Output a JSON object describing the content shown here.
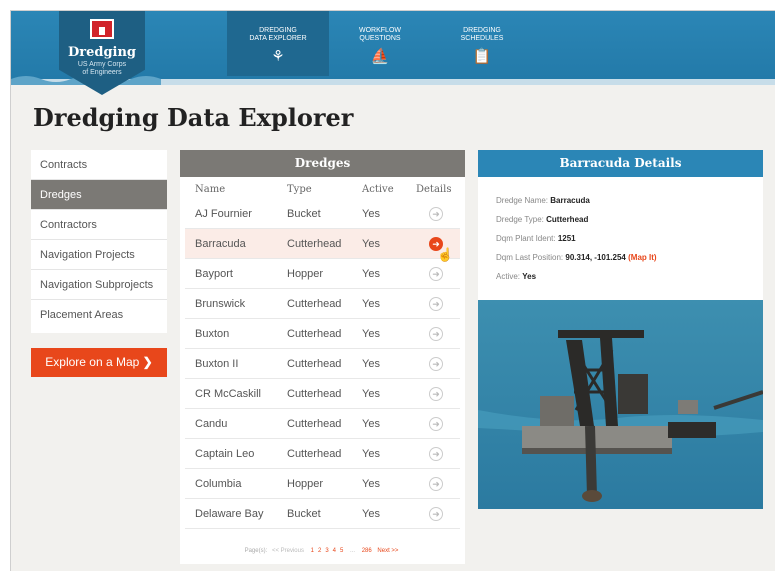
{
  "logo": {
    "title": "Dredging",
    "subtitle_line1": "US Army Corps",
    "subtitle_line2": "of Engineers"
  },
  "nav": [
    {
      "label_line1": "Dredging",
      "label_line2": "Data Explorer",
      "icon": "ship-icon"
    },
    {
      "label_line1": "Workflow",
      "label_line2": "Questions",
      "icon": "dredge-icon"
    },
    {
      "label_line1": "Dredging",
      "label_line2": "Schedules",
      "icon": "clipboard-icon"
    }
  ],
  "page_title": "Dredging Data Explorer",
  "sidebar": {
    "items": [
      {
        "label": "Contracts"
      },
      {
        "label": "Dredges"
      },
      {
        "label": "Contractors"
      },
      {
        "label": "Navigation Projects"
      },
      {
        "label": "Navigation Subprojects"
      },
      {
        "label": "Placement Areas"
      }
    ],
    "active_index": 1
  },
  "map_button": {
    "label": "Explore on a Map"
  },
  "dredges": {
    "title": "Dredges",
    "columns": {
      "name": "Name",
      "type": "Type",
      "active": "Active",
      "details": "Details"
    },
    "rows": [
      {
        "name": "AJ Fournier",
        "type": "Bucket",
        "active": "Yes"
      },
      {
        "name": "Barracuda",
        "type": "Cutterhead",
        "active": "Yes"
      },
      {
        "name": "Bayport",
        "type": "Hopper",
        "active": "Yes"
      },
      {
        "name": "Brunswick",
        "type": "Cutterhead",
        "active": "Yes"
      },
      {
        "name": "Buxton",
        "type": "Cutterhead",
        "active": "Yes"
      },
      {
        "name": "Buxton II",
        "type": "Cutterhead",
        "active": "Yes"
      },
      {
        "name": "CR McCaskill",
        "type": "Cutterhead",
        "active": "Yes"
      },
      {
        "name": "Candu",
        "type": "Cutterhead",
        "active": "Yes"
      },
      {
        "name": "Captain Leo",
        "type": "Cutterhead",
        "active": "Yes"
      },
      {
        "name": "Columbia",
        "type": "Hopper",
        "active": "Yes"
      },
      {
        "name": "Delaware Bay",
        "type": "Bucket",
        "active": "Yes"
      }
    ],
    "highlighted_row": 1,
    "pager": {
      "prefix": "Page(s):",
      "previous": "<< Previous",
      "pages": [
        "1",
        "2",
        "3",
        "4",
        "5"
      ],
      "ellipsis": "...",
      "last": "286",
      "next": "Next >>"
    }
  },
  "details": {
    "title": "Barracuda Details",
    "fields": [
      {
        "label": "Dredge Name:",
        "value": "Barracuda"
      },
      {
        "label": "Dredge Type:",
        "value": "Cutterhead"
      },
      {
        "label": "Dqm Plant Ident:",
        "value": "1251"
      },
      {
        "label": "Dqm Last Position:",
        "value": "90.314, -101.254",
        "link": "(Map It)"
      },
      {
        "label": "Active:",
        "value": "Yes"
      }
    ]
  },
  "colors": {
    "header_blue": "#2b86b6",
    "accent_orange": "#e8471b",
    "panel_grey": "#7b7975"
  }
}
